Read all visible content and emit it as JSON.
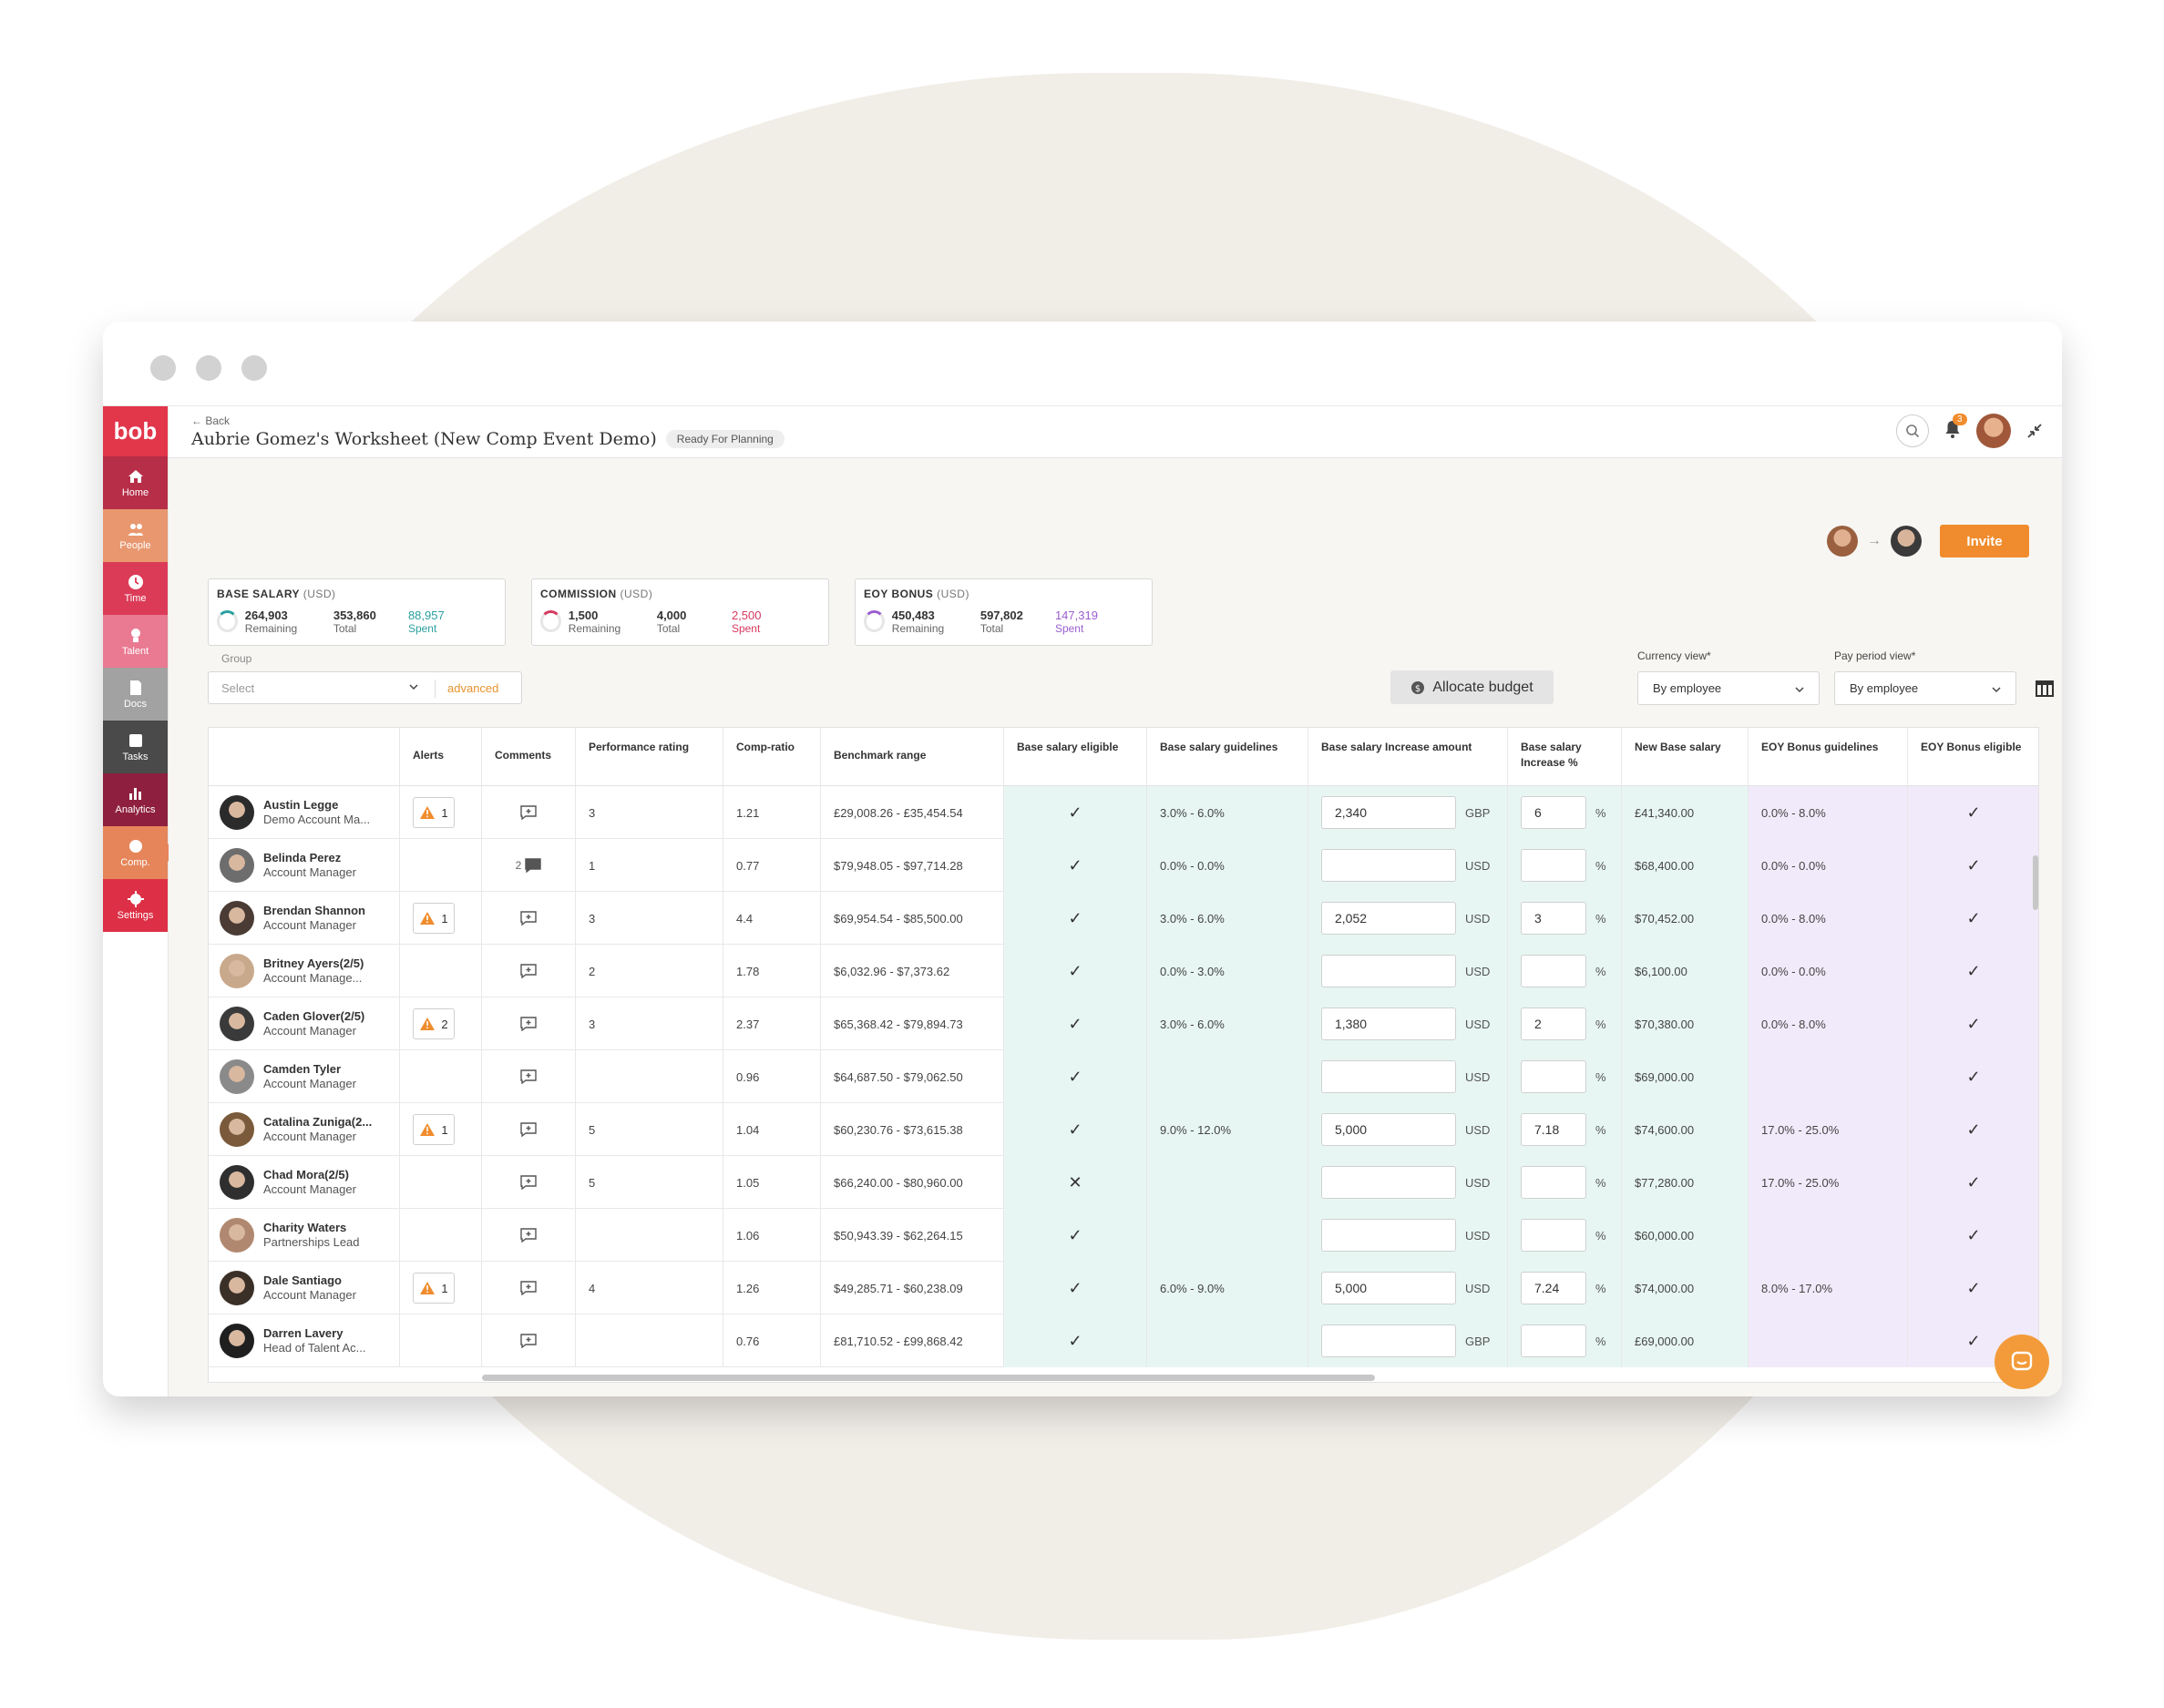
{
  "window": {
    "traffic_lights": 3
  },
  "sidebar": {
    "logo": "bob",
    "items": [
      {
        "label": "Home",
        "icon": "home-icon",
        "color": "#b72e48"
      },
      {
        "label": "People",
        "icon": "people-icon",
        "color": "#e8976f"
      },
      {
        "label": "Time",
        "icon": "clock-icon",
        "color": "#dc3b57"
      },
      {
        "label": "Talent",
        "icon": "talent-icon",
        "color": "#e97a92"
      },
      {
        "label": "Docs",
        "icon": "docs-icon",
        "color": "#a2a2a2"
      },
      {
        "label": "Tasks",
        "icon": "tasks-icon",
        "color": "#4a4a4a"
      },
      {
        "label": "Analytics",
        "icon": "analytics-icon",
        "color": "#8e1f3f"
      },
      {
        "label": "Comp.",
        "icon": "comp-icon",
        "color": "#e6855a"
      },
      {
        "label": "Settings",
        "icon": "gear-icon",
        "color": "#dd3046"
      }
    ]
  },
  "header": {
    "back": "Back",
    "title": "Aubrie Gomez's Worksheet (New Comp Event Demo)",
    "status": "Ready For Planning",
    "notification_count": "3"
  },
  "actions": {
    "invite": "Invite",
    "allocate": "Allocate budget"
  },
  "budgets": [
    {
      "title": "BASE SALARY",
      "currency": "(USD)",
      "remaining": "264,903",
      "remaining_label": "Remaining",
      "total": "353,860",
      "total_label": "Total",
      "spent": "88,957",
      "spent_label": "Spent",
      "color": "#2a9fa0"
    },
    {
      "title": "COMMISSION",
      "currency": "(USD)",
      "remaining": "1,500",
      "remaining_label": "Remaining",
      "total": "4,000",
      "total_label": "Total",
      "spent": "2,500",
      "spent_label": "Spent",
      "color": "#d6395f"
    },
    {
      "title": "EOY BONUS",
      "currency": "(USD)",
      "remaining": "450,483",
      "remaining_label": "Remaining",
      "total": "597,802",
      "total_label": "Total",
      "spent": "147,319",
      "spent_label": "Spent",
      "color": "#9b5fcf"
    }
  ],
  "filters": {
    "group_label": "Group",
    "group_placeholder": "Select",
    "advanced": "advanced",
    "currency_label": "Currency view*",
    "currency_value": "By employee",
    "period_label": "Pay period view*",
    "period_value": "By employee"
  },
  "columns": [
    "",
    "Alerts",
    "Comments",
    "Performance rating",
    "Comp-ratio",
    "Benchmark range",
    "Base salary eligible",
    "Base salary guidelines",
    "Base salary Increase amount",
    "Base salary Increase %",
    "New Base salary",
    "EOY Bonus guidelines",
    "EOY Bonus eligible"
  ],
  "rows": [
    {
      "name": "Austin Legge",
      "title": "Demo Account Ma...",
      "alert": "1",
      "comments": "",
      "rating": "3",
      "ratio": "1.21",
      "benchmark": "£29,008.26 - £35,454.54",
      "eligible": "✓",
      "guide": "3.0% - 6.0%",
      "amount": "2,340",
      "currency": "GBP",
      "pct": "6",
      "new_salary": "£41,340.00",
      "bonus_guide": "0.0% - 8.0%",
      "bonus_eligible": "✓",
      "avatar": "#2b2b2b"
    },
    {
      "name": "Belinda Perez",
      "title": "Account Manager",
      "alert": "",
      "comments": "2",
      "rating": "1",
      "ratio": "0.77",
      "benchmark": "$79,948.05 - $97,714.28",
      "eligible": "✓",
      "guide": "0.0% - 0.0%",
      "amount": "",
      "currency": "USD",
      "pct": "",
      "new_salary": "$68,400.00",
      "bonus_guide": "0.0% - 0.0%",
      "bonus_eligible": "✓",
      "avatar": "#6d6d6d"
    },
    {
      "name": "Brendan Shannon",
      "title": "Account Manager",
      "alert": "1",
      "comments": "",
      "rating": "3",
      "ratio": "4.4",
      "benchmark": "$69,954.54 - $85,500.00",
      "eligible": "✓",
      "guide": "3.0% - 6.0%",
      "amount": "2,052",
      "currency": "USD",
      "pct": "3",
      "new_salary": "$70,452.00",
      "bonus_guide": "0.0% - 8.0%",
      "bonus_eligible": "✓",
      "avatar": "#4a3b35"
    },
    {
      "name": "Britney Ayers(2/5)",
      "title": "Account Manage...",
      "alert": "",
      "comments": "",
      "rating": "2",
      "ratio": "1.78",
      "benchmark": "$6,032.96 - $7,373.62",
      "eligible": "✓",
      "guide": "0.0% - 3.0%",
      "amount": "",
      "currency": "USD",
      "pct": "",
      "new_salary": "$6,100.00",
      "bonus_guide": "0.0% - 0.0%",
      "bonus_eligible": "✓",
      "avatar": "#c9a98c"
    },
    {
      "name": "Caden Glover(2/5)",
      "title": "Account Manager",
      "alert": "2",
      "comments": "",
      "rating": "3",
      "ratio": "2.37",
      "benchmark": "$65,368.42 - $79,894.73",
      "eligible": "✓",
      "guide": "3.0% - 6.0%",
      "amount": "1,380",
      "currency": "USD",
      "pct": "2",
      "new_salary": "$70,380.00",
      "bonus_guide": "0.0% - 8.0%",
      "bonus_eligible": "✓",
      "avatar": "#3a3a3a"
    },
    {
      "name": "Camden Tyler",
      "title": "Account Manager",
      "alert": "",
      "comments": "",
      "rating": "",
      "ratio": "0.96",
      "benchmark": "$64,687.50 - $79,062.50",
      "eligible": "✓",
      "guide": "",
      "amount": "",
      "currency": "USD",
      "pct": "",
      "new_salary": "$69,000.00",
      "bonus_guide": "",
      "bonus_eligible": "✓",
      "avatar": "#8a8a8a"
    },
    {
      "name": "Catalina Zuniga(2...",
      "title": "Account Manager",
      "alert": "1",
      "comments": "",
      "rating": "5",
      "ratio": "1.04",
      "benchmark": "$60,230.76 - $73,615.38",
      "eligible": "✓",
      "guide": "9.0% - 12.0%",
      "amount": "5,000",
      "currency": "USD",
      "pct": "7.18",
      "new_salary": "$74,600.00",
      "bonus_guide": "17.0% - 25.0%",
      "bonus_eligible": "✓",
      "avatar": "#7a5a3a"
    },
    {
      "name": "Chad Mora(2/5)",
      "title": "Account Manager",
      "alert": "",
      "comments": "",
      "rating": "5",
      "ratio": "1.05",
      "benchmark": "$66,240.00 - $80,960.00",
      "eligible": "✕",
      "guide": "",
      "amount": "",
      "currency": "USD",
      "pct": "",
      "new_salary": "$77,280.00",
      "bonus_guide": "17.0% - 25.0%",
      "bonus_eligible": "✓",
      "avatar": "#2f2f2f"
    },
    {
      "name": "Charity Waters",
      "title": "Partnerships Lead",
      "alert": "",
      "comments": "",
      "rating": "",
      "ratio": "1.06",
      "benchmark": "$50,943.39 - $62,264.15",
      "eligible": "✓",
      "guide": "",
      "amount": "",
      "currency": "USD",
      "pct": "",
      "new_salary": "$60,000.00",
      "bonus_guide": "",
      "bonus_eligible": "✓",
      "avatar": "#b08870"
    },
    {
      "name": "Dale Santiago",
      "title": "Account Manager",
      "alert": "1",
      "comments": "",
      "rating": "4",
      "ratio": "1.26",
      "benchmark": "$49,285.71 - $60,238.09",
      "eligible": "✓",
      "guide": "6.0% - 9.0%",
      "amount": "5,000",
      "currency": "USD",
      "pct": "7.24",
      "new_salary": "$74,000.00",
      "bonus_guide": "8.0% - 17.0%",
      "bonus_eligible": "✓",
      "avatar": "#3b3027"
    },
    {
      "name": "Darren Lavery",
      "title": "Head of Talent Ac...",
      "alert": "",
      "comments": "",
      "rating": "",
      "ratio": "0.76",
      "benchmark": "£81,710.52 - £99,868.42",
      "eligible": "✓",
      "guide": "",
      "amount": "",
      "currency": "GBP",
      "pct": "",
      "new_salary": "£69,000.00",
      "bonus_guide": "",
      "bonus_eligible": "✓",
      "avatar": "#1f1f1f"
    }
  ]
}
